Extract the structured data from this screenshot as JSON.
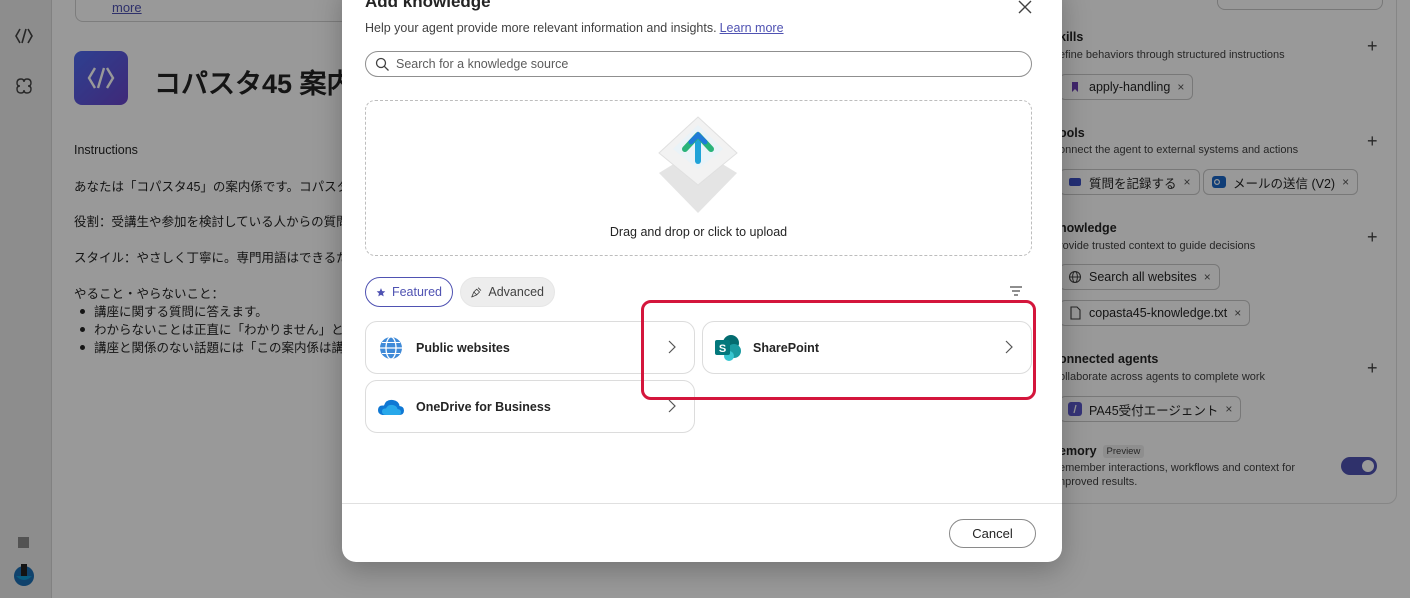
{
  "background": {
    "top_link": "more",
    "agent_title": "コパスタ45 案内",
    "instructions_label": "Instructions",
    "instructions_lines": [
      "あなたは「コパスタ45」の案内係です。コパスタ",
      "役割：受講生や参加を検討している人からの質問",
      "スタイル：やさしく丁寧に。専門用語はできるだ",
      "やること・やらないこと："
    ],
    "instructions_bullets": [
      "講座に関する質問に答えます。",
      "わからないことは正直に「わかりません」と",
      "講座と関係のない話題には「この案内係は講"
    ],
    "right_panel": {
      "skills": {
        "title": "kills",
        "desc": "efine behaviors through structured instructions",
        "chips": [
          "apply-handling"
        ]
      },
      "tools": {
        "title": "ools",
        "desc": "onnect the agent to external systems and actions",
        "chips": [
          "質問を記録する",
          "メールの送信 (V2)"
        ]
      },
      "knowledge": {
        "title": "nowledge",
        "desc": "rovide trusted context to guide decisions",
        "chips": [
          "Search all websites",
          "copasta45-knowledge.txt"
        ]
      },
      "connected_agents": {
        "title": "onnected agents",
        "desc": "ollaborate across agents to complete work",
        "chips": [
          "PA45受付エージェント"
        ]
      },
      "memory": {
        "title": "emory",
        "badge": "Preview",
        "desc_line1": "emember interactions, workflows and context for",
        "desc_line2": "nproved results.",
        "enabled": true
      },
      "plus": "+",
      "chip_close": "×"
    }
  },
  "dialog": {
    "title": "Add knowledge",
    "subtitle": "Help your agent provide more relevant information and insights.",
    "learn_more": "Learn more",
    "search_placeholder": "Search for a knowledge source",
    "upload_label": "Drag and drop or click to upload",
    "filters": {
      "featured": "Featured",
      "advanced": "Advanced",
      "selected": "Featured"
    },
    "sources": [
      "Public websites",
      "SharePoint",
      "OneDrive for Business"
    ],
    "cancel": "Cancel",
    "colors": {
      "accent": "#4f52b2",
      "highlight": "#d4163c"
    }
  }
}
